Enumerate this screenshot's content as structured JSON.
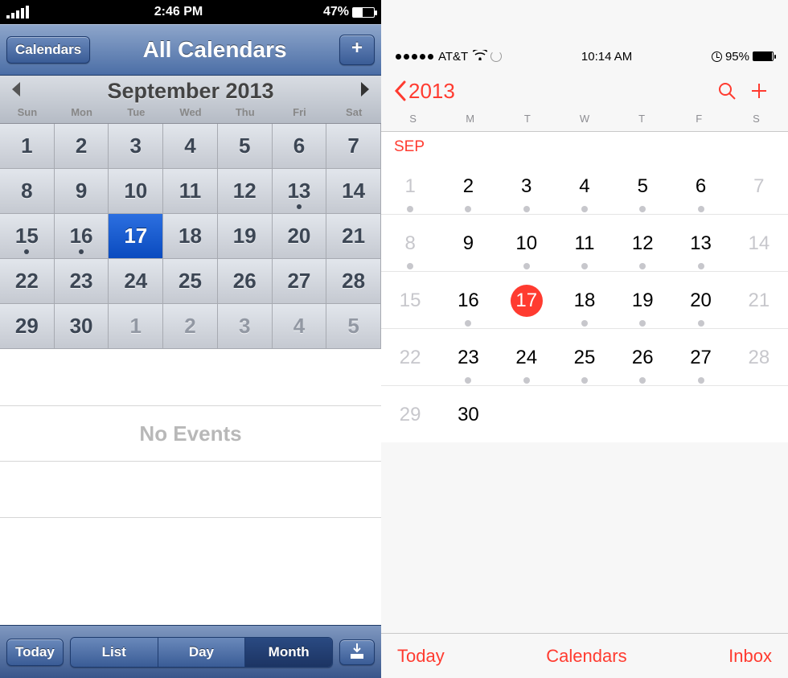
{
  "left": {
    "status": {
      "time": "2:46 PM",
      "battery": "47%"
    },
    "nav": {
      "back_label": "Calendars",
      "title": "All Calendars",
      "add_label": "+"
    },
    "month_title": "September 2013",
    "weekday_labels": [
      "Sun",
      "Mon",
      "Tue",
      "Wed",
      "Thu",
      "Fri",
      "Sat"
    ],
    "grid": [
      [
        {
          "n": "1"
        },
        {
          "n": "2"
        },
        {
          "n": "3"
        },
        {
          "n": "4"
        },
        {
          "n": "5"
        },
        {
          "n": "6"
        },
        {
          "n": "7"
        }
      ],
      [
        {
          "n": "8"
        },
        {
          "n": "9"
        },
        {
          "n": "10"
        },
        {
          "n": "11"
        },
        {
          "n": "12"
        },
        {
          "n": "13",
          "dot": true
        },
        {
          "n": "14"
        }
      ],
      [
        {
          "n": "15",
          "dot": true
        },
        {
          "n": "16",
          "dot": true
        },
        {
          "n": "17",
          "sel": true
        },
        {
          "n": "18"
        },
        {
          "n": "19"
        },
        {
          "n": "20"
        },
        {
          "n": "21"
        }
      ],
      [
        {
          "n": "22"
        },
        {
          "n": "23"
        },
        {
          "n": "24"
        },
        {
          "n": "25"
        },
        {
          "n": "26"
        },
        {
          "n": "27"
        },
        {
          "n": "28"
        }
      ],
      [
        {
          "n": "29"
        },
        {
          "n": "30"
        },
        {
          "n": "1",
          "dim": true
        },
        {
          "n": "2",
          "dim": true
        },
        {
          "n": "3",
          "dim": true
        },
        {
          "n": "4",
          "dim": true
        },
        {
          "n": "5",
          "dim": true
        }
      ]
    ],
    "no_events_label": "No Events",
    "toolbar": {
      "today": "Today",
      "list": "List",
      "day": "Day",
      "month": "Month"
    }
  },
  "right": {
    "status": {
      "carrier": "AT&T",
      "time": "10:14 AM",
      "battery": "95%"
    },
    "nav": {
      "back_label": "2013"
    },
    "weekday_labels": [
      "S",
      "M",
      "T",
      "W",
      "T",
      "F",
      "S"
    ],
    "month_label": "SEP",
    "weeks": [
      [
        {
          "n": "1",
          "dim": true,
          "dot": true
        },
        {
          "n": "2",
          "dot": true
        },
        {
          "n": "3",
          "dot": true
        },
        {
          "n": "4",
          "dot": true
        },
        {
          "n": "5",
          "dot": true
        },
        {
          "n": "6",
          "dot": true
        },
        {
          "n": "7",
          "dim": true
        }
      ],
      [
        {
          "n": "8",
          "dim": true,
          "dot": true
        },
        {
          "n": "9"
        },
        {
          "n": "10",
          "dot": true
        },
        {
          "n": "11",
          "dot": true
        },
        {
          "n": "12",
          "dot": true
        },
        {
          "n": "13",
          "dot": true
        },
        {
          "n": "14",
          "dim": true
        }
      ],
      [
        {
          "n": "15",
          "dim": true
        },
        {
          "n": "16",
          "dot": true
        },
        {
          "n": "17",
          "sel": true
        },
        {
          "n": "18",
          "dot": true
        },
        {
          "n": "19",
          "dot": true
        },
        {
          "n": "20",
          "dot": true
        },
        {
          "n": "21",
          "dim": true
        }
      ],
      [
        {
          "n": "22",
          "dim": true
        },
        {
          "n": "23",
          "dot": true
        },
        {
          "n": "24",
          "dot": true
        },
        {
          "n": "25",
          "dot": true
        },
        {
          "n": "26",
          "dot": true
        },
        {
          "n": "27",
          "dot": true
        },
        {
          "n": "28",
          "dim": true
        }
      ],
      [
        {
          "n": "29",
          "dim": true
        },
        {
          "n": "30"
        }
      ]
    ],
    "toolbar": {
      "today": "Today",
      "calendars": "Calendars",
      "inbox": "Inbox"
    }
  }
}
